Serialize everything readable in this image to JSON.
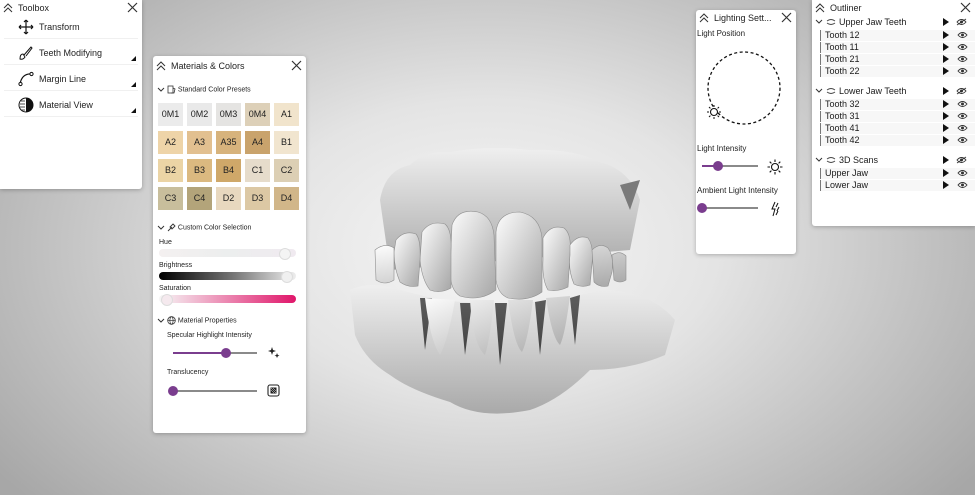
{
  "toolbox": {
    "title": "Toolbox",
    "tools": [
      {
        "label": "Transform",
        "icon": "move-arrows-icon"
      },
      {
        "label": "Teeth Modifying",
        "icon": "tooth-brush-icon"
      },
      {
        "label": "Margin Line",
        "icon": "curve-line-icon"
      },
      {
        "label": "Material View",
        "icon": "half-sphere-icon"
      }
    ]
  },
  "materials": {
    "title": "Materials & Colors",
    "presets_label": "Standard Color Presets",
    "swatches": [
      {
        "label": "0M1",
        "color": "#ebebeb"
      },
      {
        "label": "0M2",
        "color": "#e9e9e9"
      },
      {
        "label": "0M3",
        "color": "#e5e4e2"
      },
      {
        "label": "0M4",
        "color": "#ddd0b8"
      },
      {
        "label": "A1",
        "color": "#f1e4cc"
      },
      {
        "label": "A2",
        "color": "#eed4a8"
      },
      {
        "label": "A3",
        "color": "#e2c090"
      },
      {
        "label": "A35",
        "color": "#d7b37c"
      },
      {
        "label": "A4",
        "color": "#c9a36c"
      },
      {
        "label": "B1",
        "color": "#f1e5cf"
      },
      {
        "label": "B2",
        "color": "#ebd4a5"
      },
      {
        "label": "B3",
        "color": "#dbb980"
      },
      {
        "label": "B4",
        "color": "#cfa869"
      },
      {
        "label": "C1",
        "color": "#e6dccb"
      },
      {
        "label": "C2",
        "color": "#dccfb4"
      },
      {
        "label": "C3",
        "color": "#c8be9c"
      },
      {
        "label": "C4",
        "color": "#b3a47a"
      },
      {
        "label": "D2",
        "color": "#e8d8bf"
      },
      {
        "label": "D3",
        "color": "#dcc8a4"
      },
      {
        "label": "D4",
        "color": "#d1b689"
      }
    ],
    "custom_label": "Custom Color Selection",
    "hue_label": "Hue",
    "brightness_label": "Brightness",
    "saturation_label": "Saturation",
    "saturation_color": "#e0166a",
    "material_props_label": "Material Properties",
    "specular_label": "Specular Highlight Intensity",
    "specular_value": 0.63,
    "translucency_label": "Translucency",
    "translucency_value": 0.0
  },
  "lighting": {
    "title": "Lighting Sett...",
    "position_label": "Light Position",
    "intensity_label": "Light Intensity",
    "intensity_value": 0.28,
    "ambient_label": "Ambient Light Intensity",
    "ambient_value": 0.0
  },
  "outliner": {
    "title": "Outliner",
    "groups": [
      {
        "label": "Upper Jaw Teeth",
        "items": [
          "Tooth 12",
          "Tooth 11",
          "Tooth 21",
          "Tooth 22"
        ]
      },
      {
        "label": "Lower Jaw Teeth",
        "items": [
          "Tooth 32",
          "Tooth 31",
          "Tooth 41",
          "Tooth 42"
        ]
      },
      {
        "label": "3D Scans",
        "items": [
          "Upper Jaw",
          "Lower Jaw"
        ]
      }
    ]
  },
  "accent_color": "#7a3d8e"
}
